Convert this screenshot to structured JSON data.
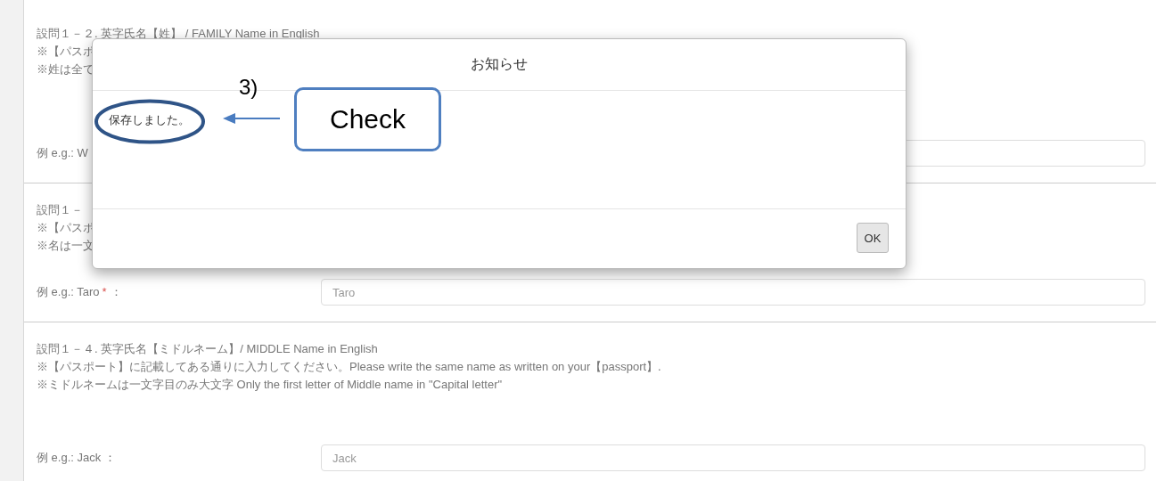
{
  "sections": [
    {
      "title": "設問１－２. 英字氏名【姓】 / FAMILY Name in English",
      "notes": [
        "※【パスポ",
        "※姓は全て"
      ],
      "example_label": "例 e.g.: W"
    },
    {
      "title": "設問１－",
      "notes": [
        "※【パスポ",
        "※名は一文"
      ],
      "example_label": "例 e.g.: Taro",
      "required_mark": "*",
      "colon": "：",
      "input": {
        "placeholder": "Taro"
      }
    },
    {
      "title": "設問１－４. 英字氏名【ミドルネーム】/ MIDDLE Name in English",
      "notes": [
        "※【パスポート】に記載してある通りに入力してください。Please write the same name as written on your【passport】.",
        "※ミドルネームは一文字目のみ大文字  Only the first letter of Middle name in \"Capital letter\""
      ],
      "example_label": "例 e.g.: Jack",
      "colon": "：",
      "input": {
        "placeholder": "Jack"
      }
    }
  ],
  "dialog": {
    "title": "お知らせ",
    "message": "保存しました。",
    "button": "OK"
  },
  "annotation": {
    "step": "3)",
    "callout": "Check"
  }
}
